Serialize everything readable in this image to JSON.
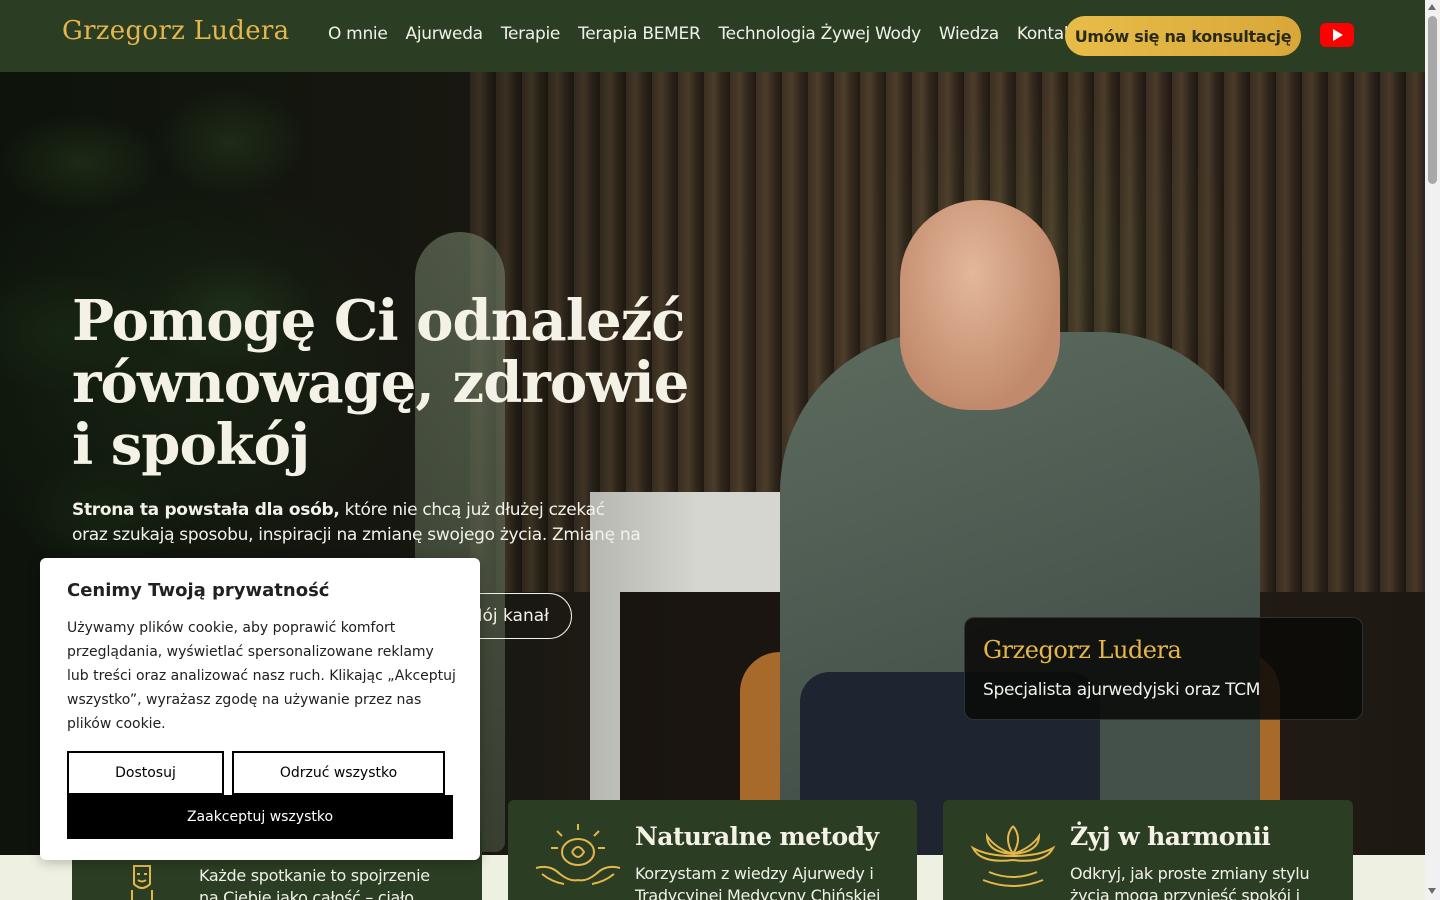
{
  "header": {
    "logo": "Grzegorz Ludera",
    "nav": [
      "O mnie",
      "Ajurweda",
      "Terapie",
      "Terapia BEMER",
      "Technologia Żywej Wody",
      "Wiedza",
      "Kontakt"
    ],
    "cta_label": "Umów się na konsultację",
    "youtube_icon": "youtube-icon"
  },
  "hero": {
    "title_line1": "Pomogę Ci odnaleźć",
    "title_line2": "równowagę, zdrowie",
    "title_line3": "i spokój",
    "text_bold": "Strona ta powstała dla osób,",
    "text_rest": " które nie chcą już dłużej czekać oraz szukają sposobu, inspiracji na zmianę swojego życia. Zmianę na",
    "channel_button": "Mój kanał",
    "name_card_title": "Grzegorz Ludera",
    "name_card_subtitle": "Specjalista ajurwedyjski oraz TCM"
  },
  "features": [
    {
      "title": "",
      "text": "Każde spotkanie to spojrzenie na Ciebie jako całość – ciało, umysł i",
      "icon": "head-icon"
    },
    {
      "title": "Naturalne metody",
      "text": "Korzystam z wiedzy Ajurwedy i Tradycyjnej Medycyny Chińskiej",
      "icon": "hands-leaf-icon"
    },
    {
      "title": "Żyj w harmonii",
      "text": "Odkryj, jak proste zmiany stylu życia mogą przynieść spokój i",
      "icon": "lotus-icon"
    }
  ],
  "cookie": {
    "title": "Cenimy Twoją prywatność",
    "body": "Używamy plików cookie, aby poprawić komfort przeglądania, wyświetlać spersonalizowane reklamy lub treści oraz analizować nasz ruch. Klikając „Akceptuj wszystko”, wyrażasz zgodę na używanie przez nas plików cookie.",
    "customize": "Dostosuj",
    "reject": "Odrzuć wszystko",
    "accept": "Zaakceptuj wszystko"
  },
  "colors": {
    "header_bg": "#2b3d22",
    "accent_gold": "#e5b64a",
    "card_green": "#2b3d22"
  }
}
